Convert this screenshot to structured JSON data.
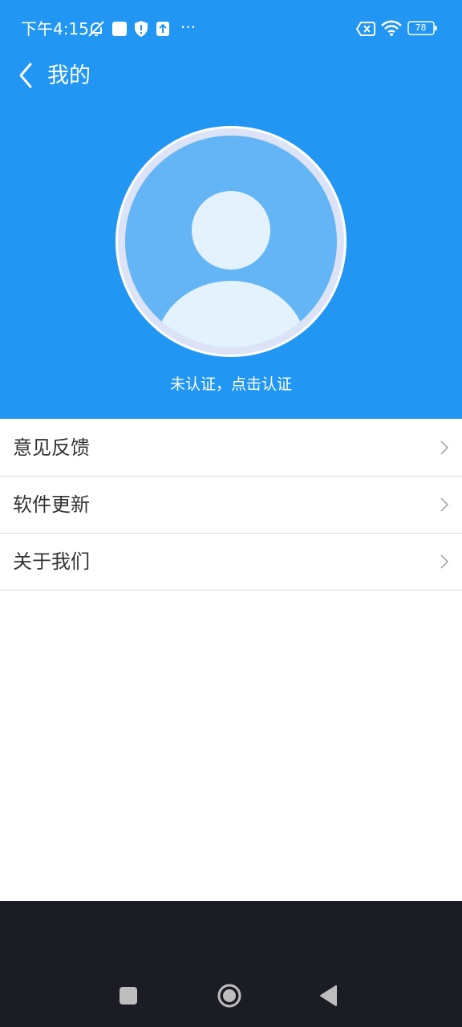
{
  "status_bar": {
    "time": "下午4:15",
    "more_label": "···",
    "battery_level": "78",
    "icons": [
      "bell-off-icon",
      "square-notification-icon",
      "shield-icon",
      "upload-icon",
      "sim-off-icon",
      "wifi-icon",
      "battery-icon"
    ]
  },
  "header": {
    "title": "我的",
    "back_icon": "chevron-left-icon",
    "background_color": "#2196F3"
  },
  "profile": {
    "avatar_icon": "user-avatar-icon",
    "cert_text": "未认证，点击认证"
  },
  "menu": {
    "items": [
      {
        "label": "意见反馈",
        "icon": "chevron-right-icon"
      },
      {
        "label": "软件更新",
        "icon": "chevron-right-icon"
      },
      {
        "label": "关于我们",
        "icon": "chevron-right-icon"
      }
    ]
  },
  "nav_bar": {
    "icons": [
      "recents-square-icon",
      "home-circle-icon",
      "back-triangle-icon"
    ]
  }
}
